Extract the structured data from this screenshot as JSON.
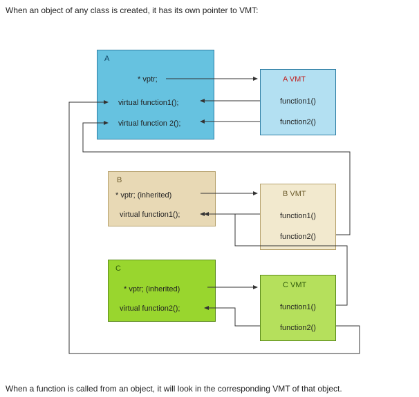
{
  "captions": {
    "top": "When an object of any class is created, it has its own pointer to VMT:",
    "bottom": "When a function is called from an object, it will look in the corresponding VMT of that object."
  },
  "classes": {
    "A": {
      "name": "A",
      "members": {
        "vptr": "* vptr;",
        "fn1": "virtual function1();",
        "fn2": "virtual function 2();"
      }
    },
    "B": {
      "name": "B",
      "members": {
        "vptr": "* vptr; (inherited)",
        "fn1": "virtual function1();"
      }
    },
    "C": {
      "name": "C",
      "members": {
        "vptr": "* vptr; (inherited)",
        "fn2": "virtual function2();"
      }
    }
  },
  "vmts": {
    "A": {
      "title": "A VMT",
      "fn1": "function1()",
      "fn2": "function2()"
    },
    "B": {
      "title": "B VMT",
      "fn1": "function1()",
      "fn2": "function2()"
    },
    "C": {
      "title": "C VMT",
      "fn1": "function1()",
      "fn2": "function2()"
    }
  },
  "diagram_data": {
    "type": "vmt-pointer-diagram",
    "description": "Three classes A, B, C each containing a vptr and virtual function declarations, with arrows from vptr to class-specific VMT, and arrows from VMT entries back to the defining class's function implementation.",
    "classes": [
      {
        "name": "A",
        "vptr": "own",
        "declares": [
          "function1",
          "function2"
        ]
      },
      {
        "name": "B",
        "vptr": "inherited",
        "declares": [
          "function1"
        ],
        "inherits_from": "A"
      },
      {
        "name": "C",
        "vptr": "inherited",
        "declares": [
          "function2"
        ],
        "inherits_from": "A"
      }
    ],
    "vmt_mappings": [
      {
        "vmt": "A",
        "function1_impl": "A",
        "function2_impl": "A"
      },
      {
        "vmt": "B",
        "function1_impl": "B",
        "function2_impl": "A"
      },
      {
        "vmt": "C",
        "function1_impl": "B",
        "function2_impl": "C"
      }
    ],
    "vptr_arrows": [
      {
        "from_class": "A",
        "to_vmt": "A"
      },
      {
        "from_class": "B",
        "to_vmt": "B"
      },
      {
        "from_class": "C",
        "to_vmt": "C"
      }
    ]
  }
}
